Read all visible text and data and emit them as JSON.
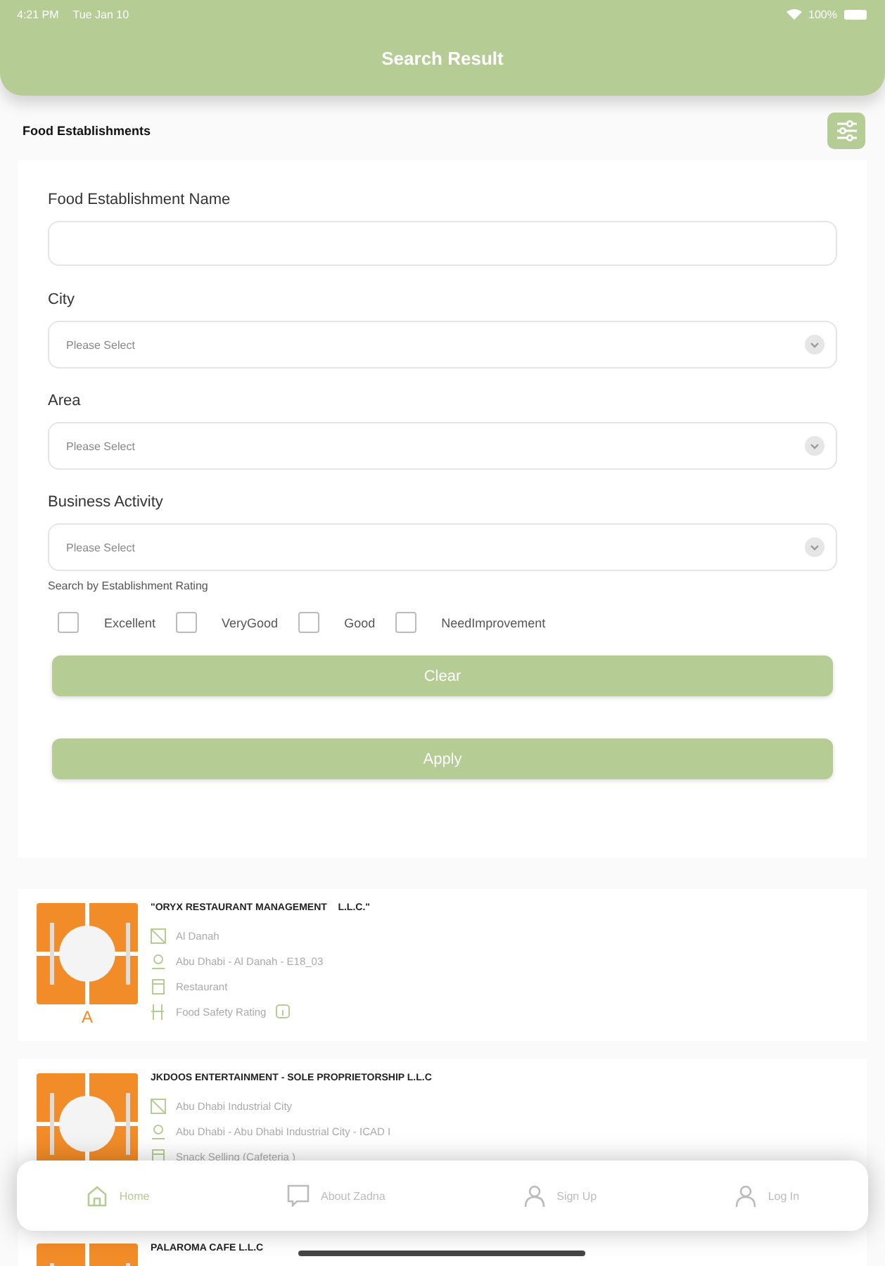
{
  "status_bar": {
    "time": "4:21 PM",
    "date": "Tue Jan 10",
    "battery": "100%"
  },
  "header": {
    "title": "Search Result"
  },
  "section": {
    "title": "Food Establishments"
  },
  "form": {
    "name_field": {
      "label": "Food Establishment Name"
    },
    "selects": [
      {
        "label": "City",
        "placeholder": "Please Select"
      },
      {
        "label": "Area",
        "placeholder": "Please Select"
      },
      {
        "label": "Business Activity",
        "placeholder": "Please Select"
      }
    ],
    "rating_label": "Search by Establishment Rating",
    "ratings": [
      {
        "label": "Excellent",
        "checked": false
      },
      {
        "label": "VeryGood",
        "checked": false
      },
      {
        "label": "Good",
        "checked": false
      },
      {
        "label": "NeedImprovement",
        "checked": false
      }
    ],
    "buttons": [
      "Clear",
      "Apply"
    ]
  },
  "results": [
    {
      "name": "\"ORYX RESTAURANT MANAGEMENT    L.L.C.\"",
      "grade": "A",
      "details": [
        {
          "kind": "area",
          "text": "Al Danah"
        },
        {
          "kind": "address",
          "text": "Abu Dhabi - Al Danah - E18_03"
        },
        {
          "kind": "activity",
          "text": "Restaurant"
        },
        {
          "kind": "rating",
          "text": "Food Safety Rating"
        }
      ]
    },
    {
      "name": "JKDOOS ENTERTAINMENT - SOLE PROPRIETORSHIP L.L.C",
      "details": [
        {
          "kind": "area",
          "text": "Abu Dhabi Industrial City"
        },
        {
          "kind": "address",
          "text": "Abu Dhabi - Abu Dhabi Industrial City - ICAD I"
        },
        {
          "kind": "activity",
          "text": "Snack Selling (Cafeteria )"
        }
      ]
    },
    {
      "name": "PALAROMA CAFE L.L.C"
    }
  ],
  "nav": [
    {
      "kind": "home",
      "label": "Home",
      "selected": true
    },
    {
      "kind": "about",
      "label": "About Zadna",
      "selected": false
    },
    {
      "kind": "user",
      "label": "Sign Up",
      "selected": false
    },
    {
      "kind": "user",
      "label": "Log In",
      "selected": false
    }
  ]
}
